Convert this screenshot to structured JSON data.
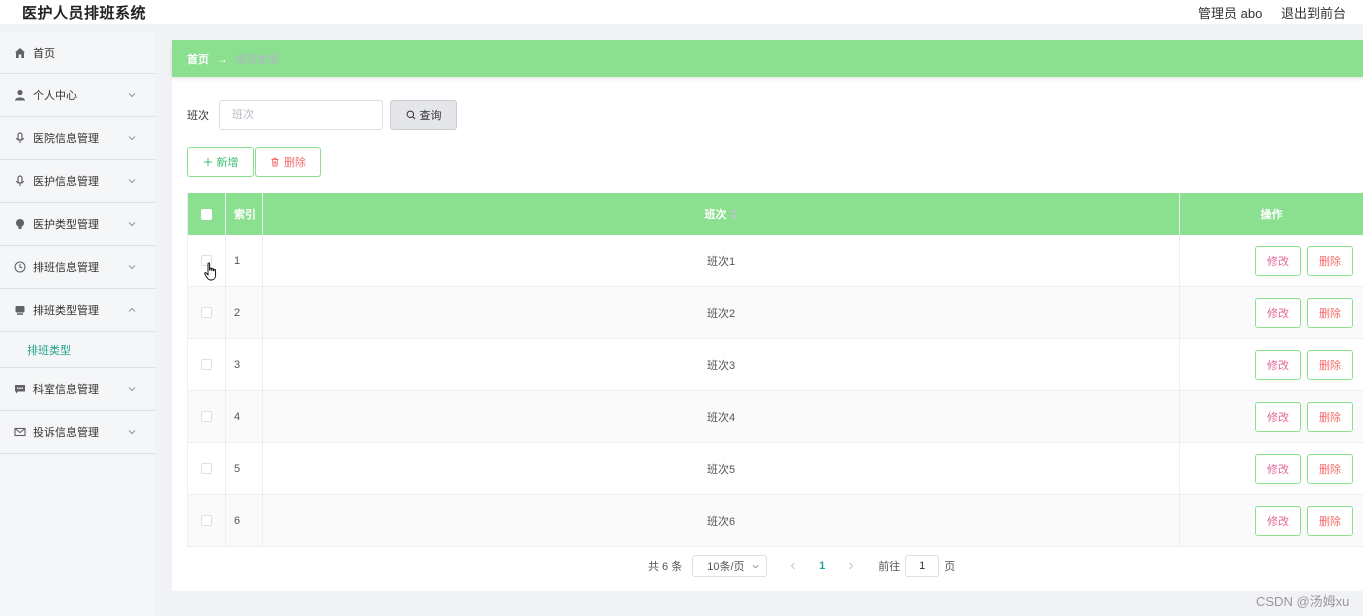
{
  "header": {
    "app_title": "医护人员排班系统",
    "user_label": "管理员 abo",
    "exit_front_label": "退出到前台",
    "exit_label": "退"
  },
  "sidebar": {
    "items": [
      {
        "label": "首页",
        "icon": "home-icon",
        "has_arrow": false
      },
      {
        "label": "个人中心",
        "icon": "user-icon",
        "has_arrow": true
      },
      {
        "label": "医院信息管理",
        "icon": "microphone-icon",
        "has_arrow": true
      },
      {
        "label": "医护信息管理",
        "icon": "microphone-icon",
        "has_arrow": true
      },
      {
        "label": "医护类型管理",
        "icon": "lightbulb-icon",
        "has_arrow": true
      },
      {
        "label": "排班信息管理",
        "icon": "clock-icon",
        "has_arrow": true
      },
      {
        "label": "排班类型管理",
        "icon": "monitor-icon",
        "has_arrow": true,
        "expanded": true
      },
      {
        "label": "科室信息管理",
        "icon": "chat-icon",
        "has_arrow": true
      },
      {
        "label": "投诉信息管理",
        "icon": "mail-icon",
        "has_arrow": true
      }
    ],
    "submenu": {
      "label": "排班类型"
    }
  },
  "breadcrumb": {
    "home": "首页",
    "separator": "→",
    "current": "排班类型"
  },
  "search": {
    "label": "班次",
    "placeholder": "班次",
    "button_label": "查询"
  },
  "actions": {
    "add_label": "新增",
    "delete_label": "删除"
  },
  "table": {
    "headers": {
      "index": "索引",
      "name": "班次",
      "op": "操作"
    },
    "rows": [
      {
        "index": "1",
        "name": "班次1"
      },
      {
        "index": "2",
        "name": "班次2"
      },
      {
        "index": "3",
        "name": "班次3"
      },
      {
        "index": "4",
        "name": "班次4"
      },
      {
        "index": "5",
        "name": "班次5"
      },
      {
        "index": "6",
        "name": "班次6"
      }
    ],
    "edit_label": "修改",
    "delete_label": "删除"
  },
  "pagination": {
    "total": "共 6 条",
    "page_size": "10条/页",
    "current_page": "1",
    "goto_prefix": "前往",
    "goto_value": "1",
    "goto_suffix": "页"
  },
  "watermark": "CSDN @汤姆xu",
  "colors": {
    "accent_green": "#8ae08f",
    "link_teal": "#1fa388",
    "edit_pink": "#e06a9a",
    "delete_red": "#f56c6c"
  }
}
